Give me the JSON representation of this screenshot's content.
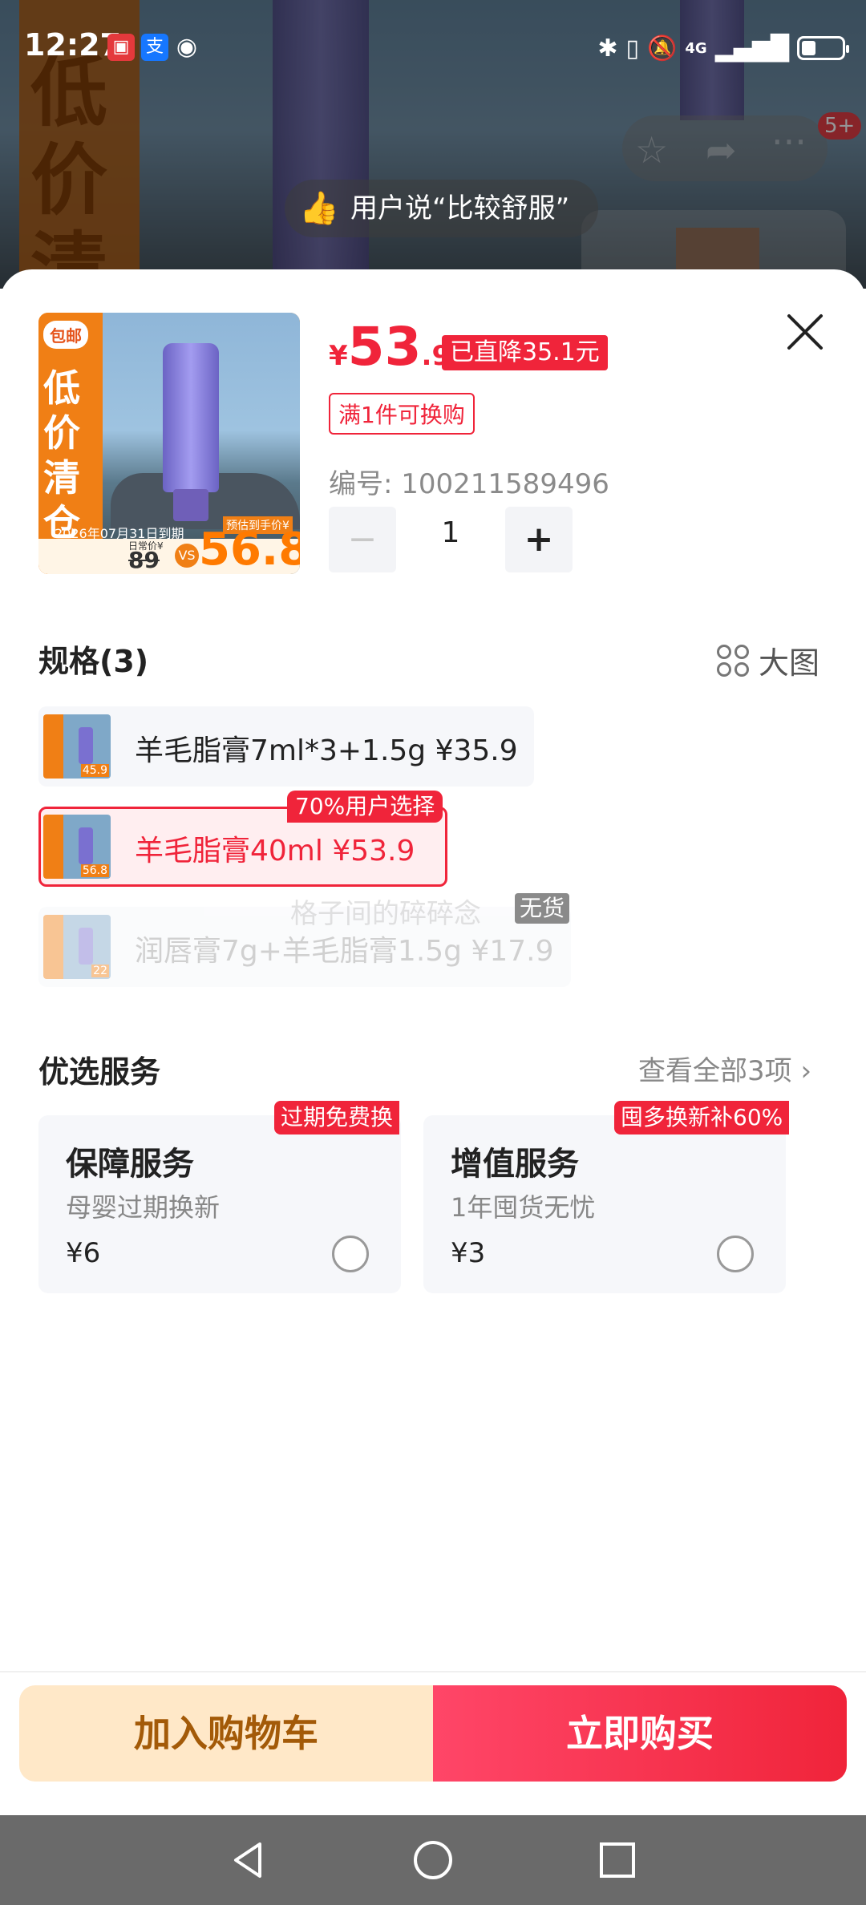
{
  "status_bar": {
    "time": "12:27",
    "network": "4G",
    "battery_percent": 35
  },
  "background": {
    "tip_text": "用户说“比较舒服”",
    "badge_count": "5+",
    "band_text": "低价清"
  },
  "product_image": {
    "badge": "包邮",
    "band_text": "低价清仓",
    "expiry": "2026年07月31日到期",
    "orig_price_label": "日常价¥",
    "orig_price": "89",
    "vs": "VS",
    "est_label": "预估到手价¥",
    "est_price": "56.8"
  },
  "price": {
    "currency": "¥",
    "integer": "53",
    "decimal": ".9",
    "drop_tag": "已直降35.1元",
    "swap_tag": "满1件可换购",
    "sku_number": "编号: 100211589496"
  },
  "quantity": {
    "minus": "−",
    "value": "1",
    "plus": "+"
  },
  "specs": {
    "title": "规格(3)",
    "big_view": "大图",
    "items": [
      {
        "label": "羊毛脂膏7ml*3+1.5g   ¥35.9",
        "thumb_price": "45.9",
        "state": "normal"
      },
      {
        "label": "羊毛脂膏40ml   ¥53.9",
        "thumb_price": "56.8",
        "state": "selected"
      },
      {
        "label": "润唇膏7g+羊毛脂膏1.5g   ¥17.9",
        "thumb_price": "22",
        "state": "disabled"
      }
    ],
    "popular_tag": "70%用户选择",
    "oos_tag": "无货",
    "watermark": "格子间的碎碎念"
  },
  "services": {
    "title": "优选服务",
    "see_all": "查看全部3项 ›",
    "cards": [
      {
        "tag": "过期免费换",
        "title": "保障服务",
        "subtitle": "母婴过期换新",
        "price": "¥6"
      },
      {
        "tag": "囤多换新补60%",
        "title": "增值服务",
        "subtitle": "1年囤货无忧",
        "price": "¥3"
      }
    ]
  },
  "actions": {
    "add_to_cart": "加入购物车",
    "buy_now": "立即购买"
  },
  "colors": {
    "accent": "#f0243a",
    "cart_bg": "#ffe8c8",
    "cart_text": "#a35a08"
  }
}
